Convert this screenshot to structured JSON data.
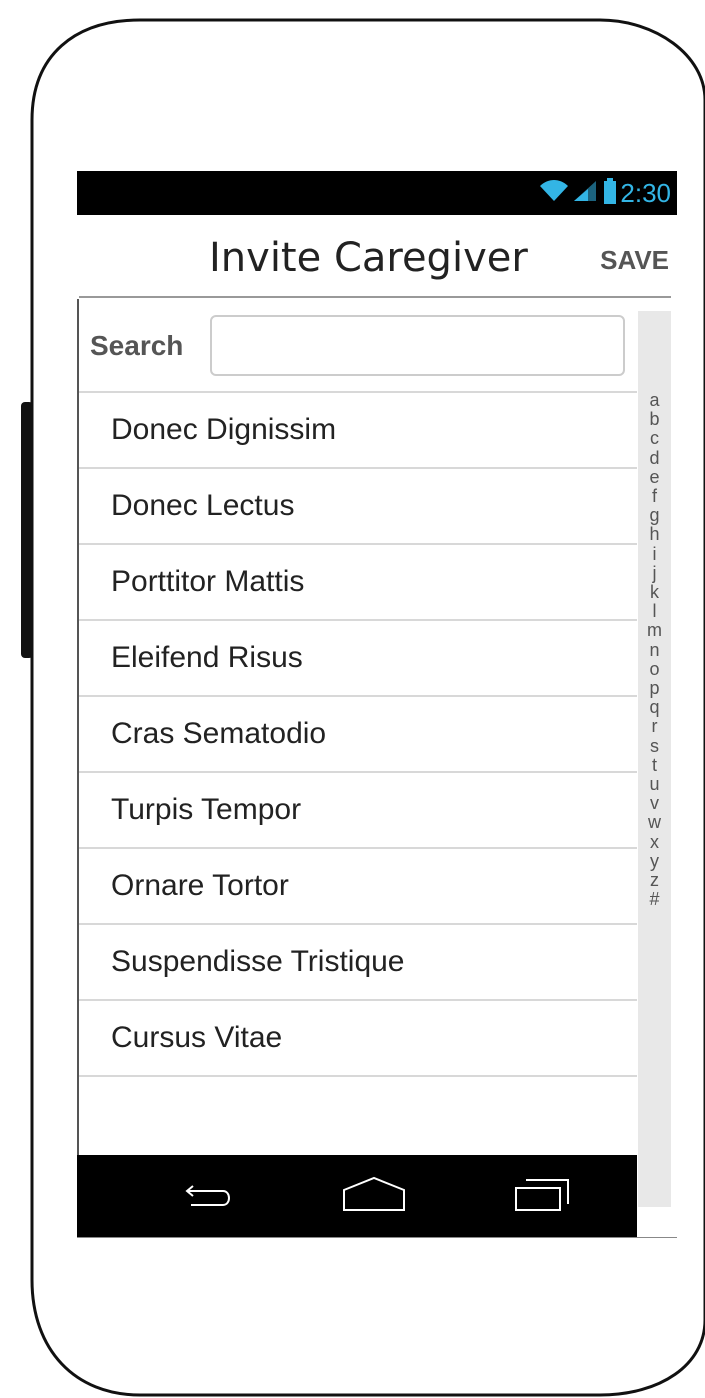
{
  "status_bar": {
    "time": "2:30",
    "accent_color": "#33b5e5",
    "icons": [
      "wifi-icon",
      "signal-icon",
      "battery-icon"
    ]
  },
  "app_bar": {
    "title": "Invite Caregiver",
    "save_label": "SAVE"
  },
  "search": {
    "label": "Search",
    "placeholder": "",
    "value": ""
  },
  "contacts": [
    "Donec Dignissim",
    "Donec Lectus",
    "Porttitor Mattis",
    "Eleifend Risus",
    "Cras Sematodio",
    "Turpis Tempor",
    "Ornare Tortor",
    "Suspendisse Tristique",
    "Cursus Vitae"
  ],
  "alphabet_index": [
    "a",
    "b",
    "c",
    "d",
    "e",
    "f",
    "g",
    "h",
    "i",
    "j",
    "k",
    "l",
    "m",
    "n",
    "o",
    "p",
    "q",
    "r",
    "s",
    "t",
    "u",
    "v",
    "w",
    "x",
    "y",
    "z",
    "#"
  ],
  "nav_bar": {
    "buttons": [
      "back-icon",
      "home-icon",
      "recent-apps-icon"
    ]
  }
}
